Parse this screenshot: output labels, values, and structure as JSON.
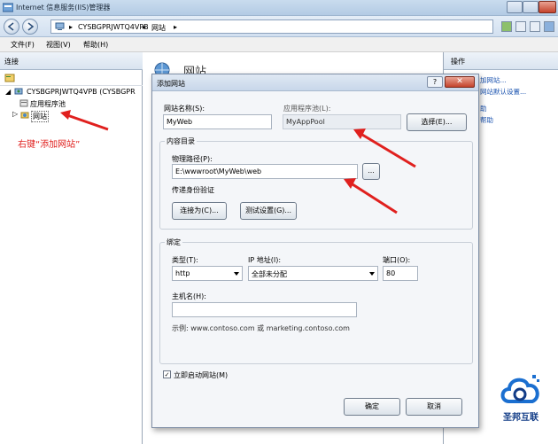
{
  "window": {
    "title": "Internet 信息服务(IIS)管理器",
    "breadcrumb": [
      "CYSBGPRJWTQ4VPB",
      "网站"
    ]
  },
  "menu": [
    "文件(F)",
    "视图(V)",
    "帮助(H)"
  ],
  "connections": {
    "header": "连接",
    "tree": {
      "server": "CYSBGPRJWTQ4VPB (CYSBGPR",
      "app_pools": "应用程序池",
      "sites": "网站"
    }
  },
  "annotation_left": "右键“添加网站”",
  "center": {
    "title": "网站"
  },
  "actions": {
    "header": "操作",
    "links": [
      "加网站...",
      "网站默认设置...",
      "助",
      "帮助"
    ]
  },
  "dialog": {
    "title": "添加网站",
    "help_label": "?",
    "close_label": "✕",
    "site_name_label": "网站名称(S):",
    "site_name_value": "MyWeb",
    "app_pool_label": "应用程序池(L):",
    "app_pool_value": "MyAppPool",
    "select_button": "选择(E)...",
    "content_dir": {
      "legend": "内容目录",
      "physical_path_label": "物理路径(P):",
      "physical_path_value": "E:\\wwwroot\\MyWeb\\web",
      "browse_button": "...",
      "passthrough_label": "传递身份验证",
      "connect_as_button": "连接为(C)...",
      "test_settings_button": "测试设置(G)..."
    },
    "binding": {
      "legend": "绑定",
      "type_label": "类型(T):",
      "type_value": "http",
      "ip_label": "IP 地址(I):",
      "ip_value": "全部未分配",
      "port_label": "端口(O):",
      "port_value": "80",
      "hostname_label": "主机名(H):",
      "hostname_value": "",
      "example": "示例: www.contoso.com 或 marketing.contoso.com"
    },
    "start_immediately_label": "立即启动网站(M)",
    "start_immediately_checked": true,
    "ok_button": "确定",
    "cancel_button": "取消"
  },
  "logo": {
    "text": "圣邦互联"
  },
  "colors": {
    "annotation_red": "#e0201e",
    "link_blue": "#1c54b0",
    "logo_blue": "#123c87"
  }
}
